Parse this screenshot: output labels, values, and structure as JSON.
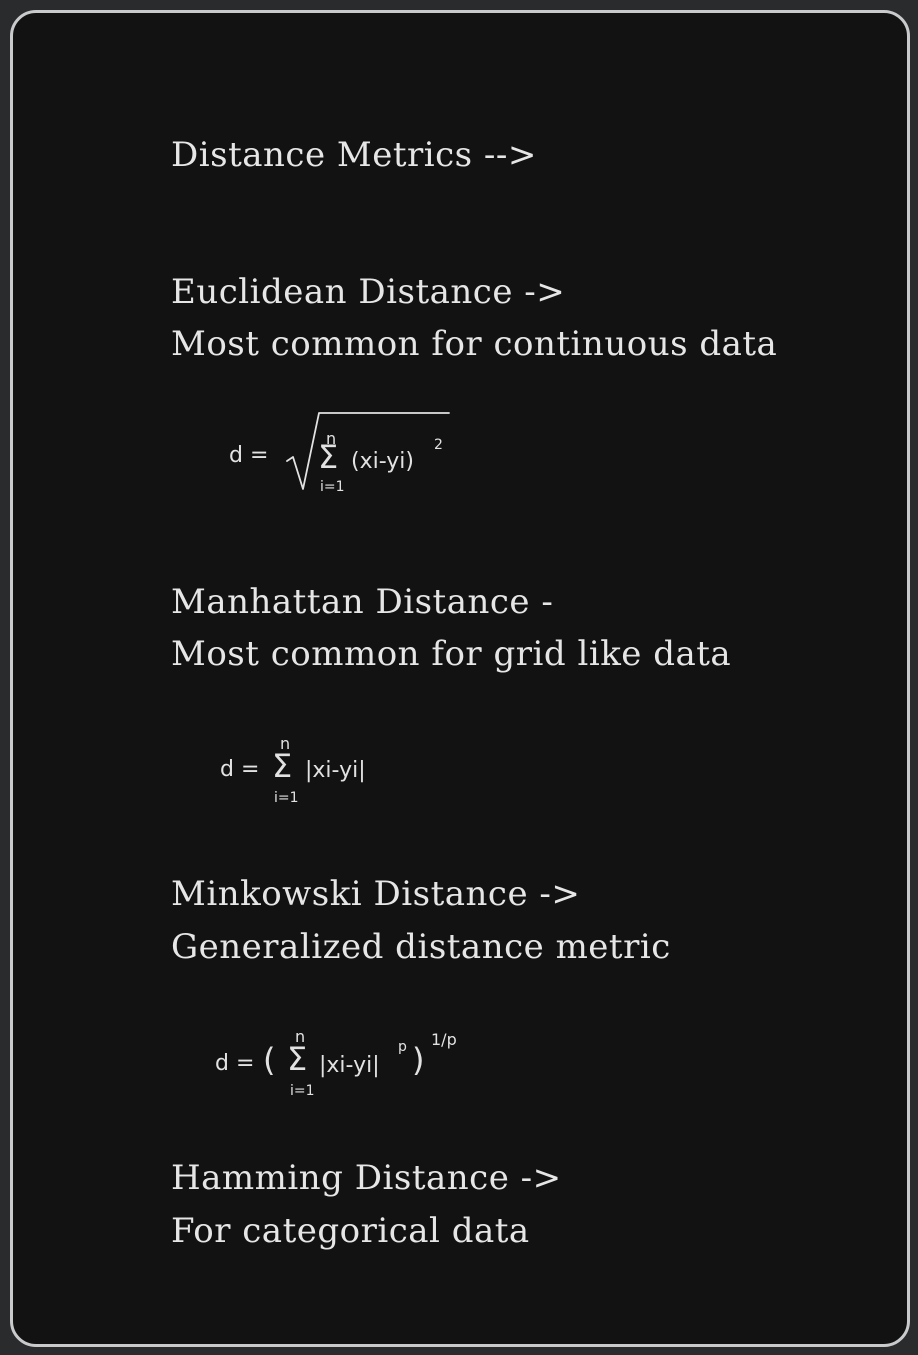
{
  "heading": "Distance Metrics -->",
  "sections": [
    {
      "title": "Euclidean Distance ->",
      "description": "Most common for continuous data",
      "formula": {
        "lhs": "d =",
        "upper": "n",
        "sigma": "Σ",
        "lower": "i=1",
        "body": "(xi-yi)",
        "power": "2"
      }
    },
    {
      "title": "Manhattan Distance -",
      "description": "Most common for grid like data",
      "formula": {
        "lhs": "d =",
        "upper": "n",
        "sigma": "Σ",
        "lower": "i=1",
        "body": "|xi-yi|"
      }
    },
    {
      "title": "Minkowski Distance ->",
      "description": "Generalized distance metric",
      "formula": {
        "lhs": "d =",
        "open": "(",
        "upper": "n",
        "sigma": "Σ",
        "lower": "i=1",
        "body": "|xi-yi|",
        "inner_power": "p",
        "close": ")",
        "outer_power": "1/p"
      }
    },
    {
      "title": "Hamming Distance ->",
      "description": "For categorical data"
    }
  ],
  "colors": {
    "background": "#121212",
    "text": "#e6e6e6",
    "border": "#c9cacb"
  }
}
